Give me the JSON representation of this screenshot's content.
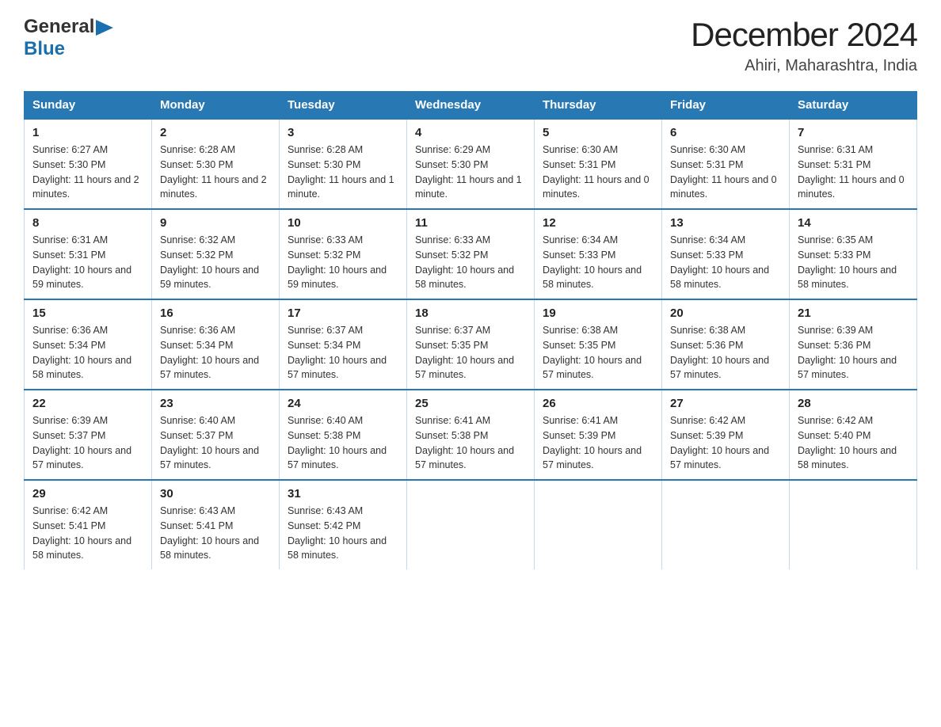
{
  "header": {
    "logo_general": "General",
    "logo_blue": "Blue",
    "month_title": "December 2024",
    "location": "Ahiri, Maharashtra, India"
  },
  "weekdays": [
    "Sunday",
    "Monday",
    "Tuesday",
    "Wednesday",
    "Thursday",
    "Friday",
    "Saturday"
  ],
  "weeks": [
    [
      {
        "day": "1",
        "sunrise": "6:27 AM",
        "sunset": "5:30 PM",
        "daylight": "11 hours and 2 minutes."
      },
      {
        "day": "2",
        "sunrise": "6:28 AM",
        "sunset": "5:30 PM",
        "daylight": "11 hours and 2 minutes."
      },
      {
        "day": "3",
        "sunrise": "6:28 AM",
        "sunset": "5:30 PM",
        "daylight": "11 hours and 1 minute."
      },
      {
        "day": "4",
        "sunrise": "6:29 AM",
        "sunset": "5:30 PM",
        "daylight": "11 hours and 1 minute."
      },
      {
        "day": "5",
        "sunrise": "6:30 AM",
        "sunset": "5:31 PM",
        "daylight": "11 hours and 0 minutes."
      },
      {
        "day": "6",
        "sunrise": "6:30 AM",
        "sunset": "5:31 PM",
        "daylight": "11 hours and 0 minutes."
      },
      {
        "day": "7",
        "sunrise": "6:31 AM",
        "sunset": "5:31 PM",
        "daylight": "11 hours and 0 minutes."
      }
    ],
    [
      {
        "day": "8",
        "sunrise": "6:31 AM",
        "sunset": "5:31 PM",
        "daylight": "10 hours and 59 minutes."
      },
      {
        "day": "9",
        "sunrise": "6:32 AM",
        "sunset": "5:32 PM",
        "daylight": "10 hours and 59 minutes."
      },
      {
        "day": "10",
        "sunrise": "6:33 AM",
        "sunset": "5:32 PM",
        "daylight": "10 hours and 59 minutes."
      },
      {
        "day": "11",
        "sunrise": "6:33 AM",
        "sunset": "5:32 PM",
        "daylight": "10 hours and 58 minutes."
      },
      {
        "day": "12",
        "sunrise": "6:34 AM",
        "sunset": "5:33 PM",
        "daylight": "10 hours and 58 minutes."
      },
      {
        "day": "13",
        "sunrise": "6:34 AM",
        "sunset": "5:33 PM",
        "daylight": "10 hours and 58 minutes."
      },
      {
        "day": "14",
        "sunrise": "6:35 AM",
        "sunset": "5:33 PM",
        "daylight": "10 hours and 58 minutes."
      }
    ],
    [
      {
        "day": "15",
        "sunrise": "6:36 AM",
        "sunset": "5:34 PM",
        "daylight": "10 hours and 58 minutes."
      },
      {
        "day": "16",
        "sunrise": "6:36 AM",
        "sunset": "5:34 PM",
        "daylight": "10 hours and 57 minutes."
      },
      {
        "day": "17",
        "sunrise": "6:37 AM",
        "sunset": "5:34 PM",
        "daylight": "10 hours and 57 minutes."
      },
      {
        "day": "18",
        "sunrise": "6:37 AM",
        "sunset": "5:35 PM",
        "daylight": "10 hours and 57 minutes."
      },
      {
        "day": "19",
        "sunrise": "6:38 AM",
        "sunset": "5:35 PM",
        "daylight": "10 hours and 57 minutes."
      },
      {
        "day": "20",
        "sunrise": "6:38 AM",
        "sunset": "5:36 PM",
        "daylight": "10 hours and 57 minutes."
      },
      {
        "day": "21",
        "sunrise": "6:39 AM",
        "sunset": "5:36 PM",
        "daylight": "10 hours and 57 minutes."
      }
    ],
    [
      {
        "day": "22",
        "sunrise": "6:39 AM",
        "sunset": "5:37 PM",
        "daylight": "10 hours and 57 minutes."
      },
      {
        "day": "23",
        "sunrise": "6:40 AM",
        "sunset": "5:37 PM",
        "daylight": "10 hours and 57 minutes."
      },
      {
        "day": "24",
        "sunrise": "6:40 AM",
        "sunset": "5:38 PM",
        "daylight": "10 hours and 57 minutes."
      },
      {
        "day": "25",
        "sunrise": "6:41 AM",
        "sunset": "5:38 PM",
        "daylight": "10 hours and 57 minutes."
      },
      {
        "day": "26",
        "sunrise": "6:41 AM",
        "sunset": "5:39 PM",
        "daylight": "10 hours and 57 minutes."
      },
      {
        "day": "27",
        "sunrise": "6:42 AM",
        "sunset": "5:39 PM",
        "daylight": "10 hours and 57 minutes."
      },
      {
        "day": "28",
        "sunrise": "6:42 AM",
        "sunset": "5:40 PM",
        "daylight": "10 hours and 58 minutes."
      }
    ],
    [
      {
        "day": "29",
        "sunrise": "6:42 AM",
        "sunset": "5:41 PM",
        "daylight": "10 hours and 58 minutes."
      },
      {
        "day": "30",
        "sunrise": "6:43 AM",
        "sunset": "5:41 PM",
        "daylight": "10 hours and 58 minutes."
      },
      {
        "day": "31",
        "sunrise": "6:43 AM",
        "sunset": "5:42 PM",
        "daylight": "10 hours and 58 minutes."
      },
      null,
      null,
      null,
      null
    ]
  ]
}
